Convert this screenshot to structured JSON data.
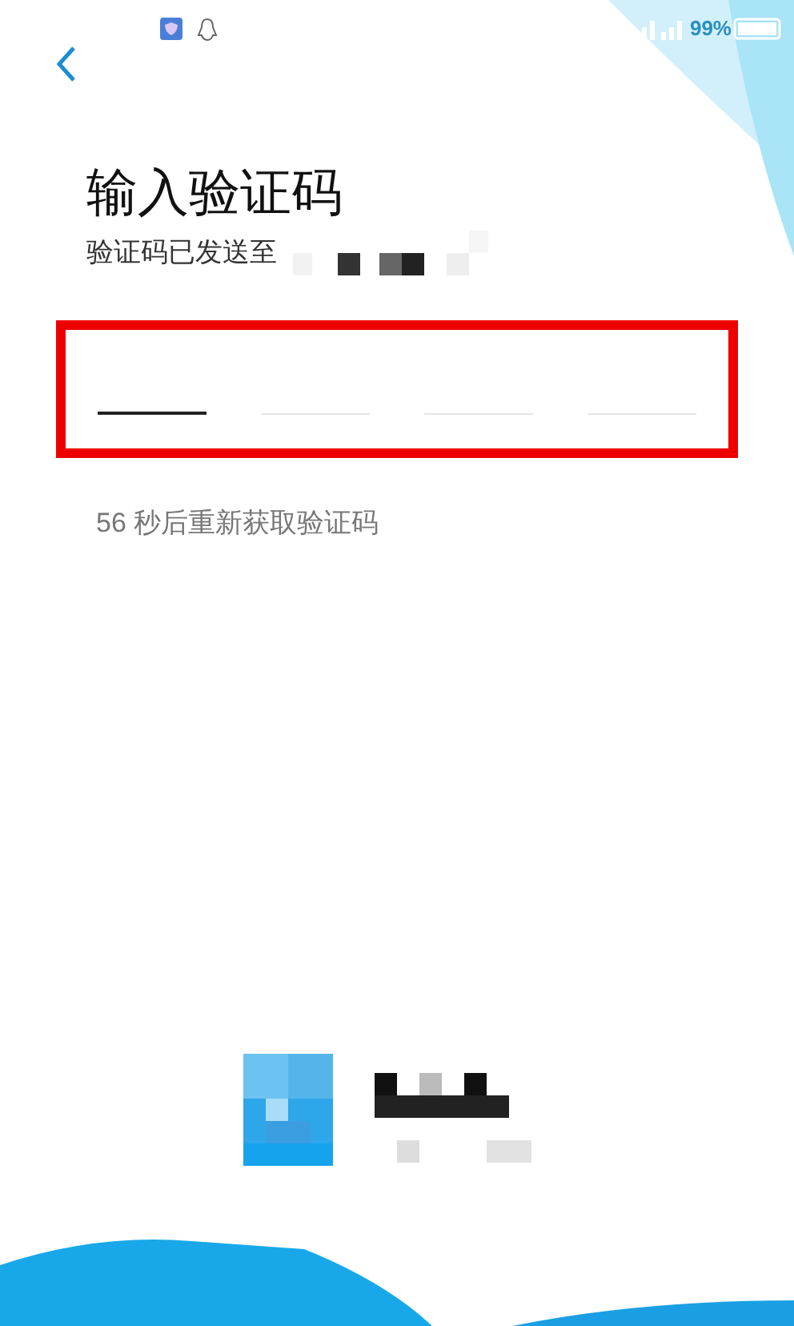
{
  "status_bar": {
    "battery": "99%"
  },
  "title": "输入验证码",
  "subtitle": "验证码已发送至",
  "code_slots": [
    {
      "selected": true
    },
    {
      "selected": false
    },
    {
      "selected": false
    },
    {
      "selected": false
    }
  ],
  "resend": "56 秒后重新获取验证码"
}
